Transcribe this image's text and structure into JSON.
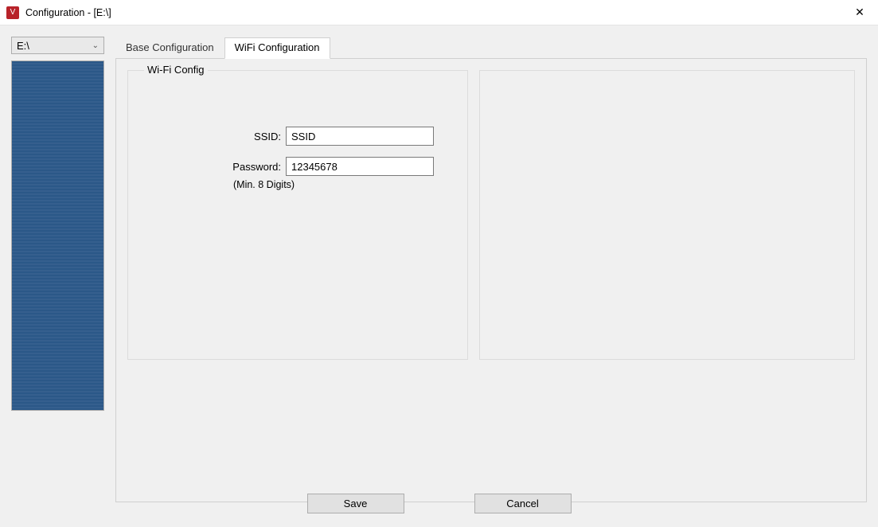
{
  "window": {
    "title": "Configuration - [E:\\]",
    "icon_letter": "V"
  },
  "sidebar": {
    "drive_selected": "E:\\"
  },
  "tabs": [
    {
      "label": "Base Configuration",
      "active": false
    },
    {
      "label": "WiFi Configuration",
      "active": true
    }
  ],
  "wifi": {
    "group_title": "Wi-Fi Config",
    "ssid_label": "SSID:",
    "ssid_value": "SSID",
    "password_label": "Password:",
    "password_value": "12345678",
    "password_hint": "(Min. 8 Digits)"
  },
  "buttons": {
    "save": "Save",
    "cancel": "Cancel"
  }
}
